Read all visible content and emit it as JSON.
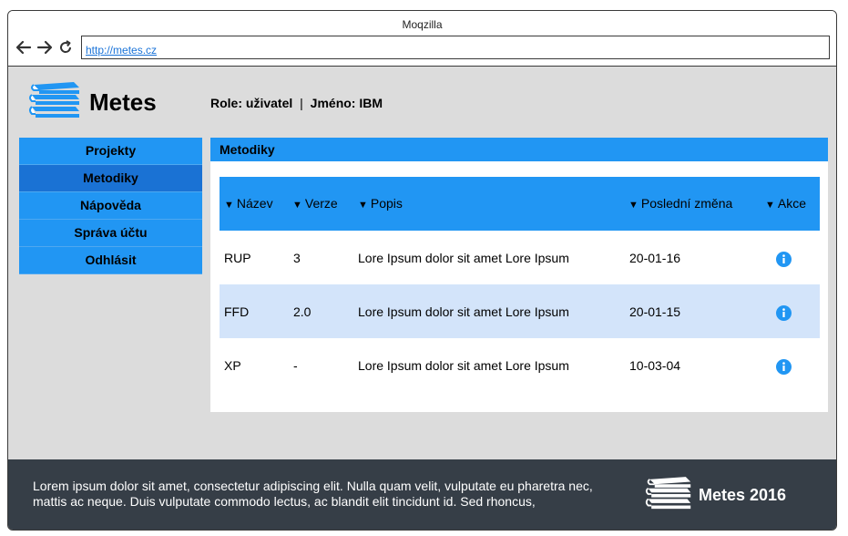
{
  "browser": {
    "window_title": "Moqzilla",
    "url": "http://metes.cz"
  },
  "header": {
    "app_name": "Metes",
    "role_label": "Role:",
    "role_value": "uživatel",
    "separator": "|",
    "name_label": "Jméno:",
    "name_value": "IBM"
  },
  "sidebar": {
    "items": [
      {
        "label": "Projekty"
      },
      {
        "label": "Metodiky"
      },
      {
        "label": "Nápověda"
      },
      {
        "label": "Správa účtu"
      },
      {
        "label": "Odhlásit"
      }
    ],
    "active": "Metodiky"
  },
  "panel": {
    "title": "Metodiky",
    "sort_arrow": "▼",
    "columns": [
      "Název",
      "Verze",
      "Popis",
      "Poslední změna",
      "Akce"
    ],
    "rows": [
      {
        "name": "RUP",
        "version": "3",
        "description": "Lore Ipsum dolor sit amet Lore Ipsum",
        "changed": "20-01-16",
        "action": "info-icon"
      },
      {
        "name": "FFD",
        "version": "2.0",
        "description": "Lore Ipsum dolor sit amet Lore Ipsum",
        "changed": "20-01-15",
        "action": "info-icon"
      },
      {
        "name": "XP",
        "version": "-",
        "description": "Lore Ipsum dolor sit amet Lore Ipsum",
        "changed": "10-03-04",
        "action": "info-icon"
      }
    ]
  },
  "footer": {
    "text": "Lorem ipsum dolor sit amet, consectetur adipiscing elit. Nulla quam velit, vulputate eu pharetra nec, mattis ac neque. Duis vulputate commodo lectus, ac blandit elit tincidunt id. Sed rhoncus,",
    "brand": "Metes 2016"
  },
  "colors": {
    "accent": "#2196f3",
    "accent_active": "#1a72d4",
    "row_highlight": "#d3e4fa",
    "footer_bg": "#363e47",
    "page_bg": "#dcdcdc"
  }
}
